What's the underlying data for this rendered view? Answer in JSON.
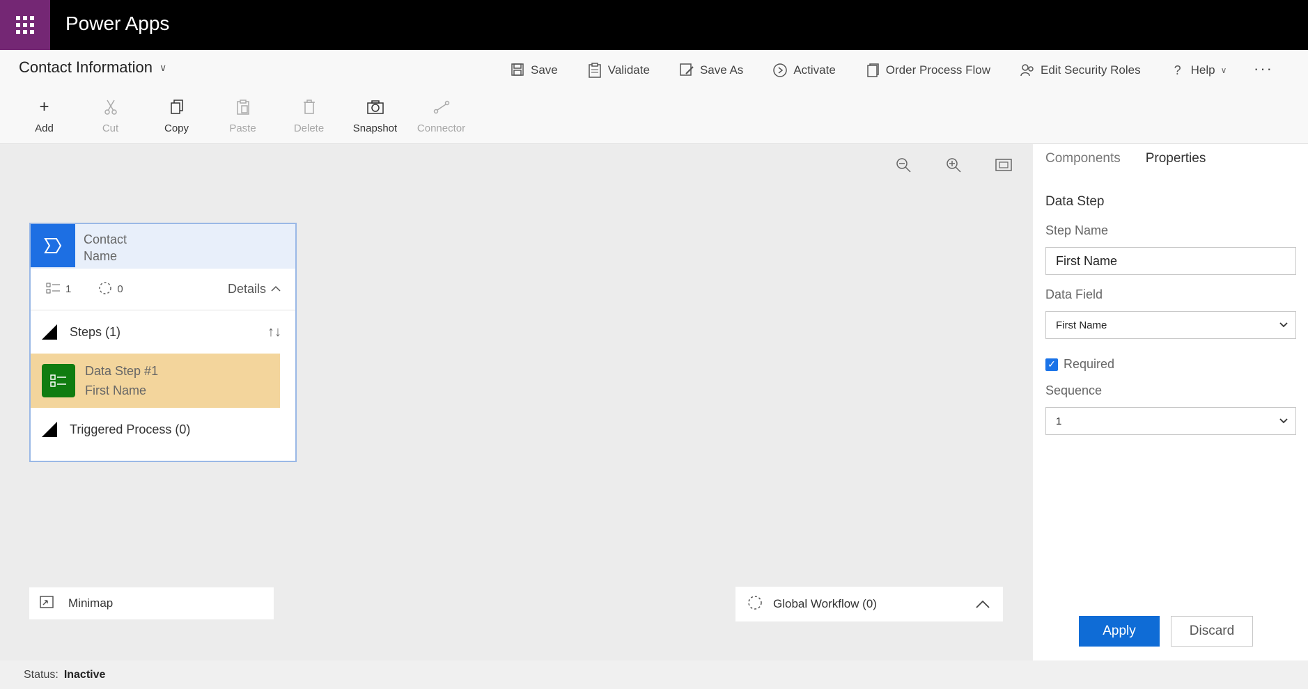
{
  "app": {
    "title": "Power Apps"
  },
  "header": {
    "process_name": "Contact Information",
    "actions": [
      {
        "label": "Save",
        "icon": "save-icon"
      },
      {
        "label": "Validate",
        "icon": "clipboard-icon"
      },
      {
        "label": "Save As",
        "icon": "save-as-icon"
      },
      {
        "label": "Activate",
        "icon": "activate-icon"
      },
      {
        "label": "Order Process Flow",
        "icon": "document-icon"
      },
      {
        "label": "Edit Security Roles",
        "icon": "people-icon"
      },
      {
        "label": "Help",
        "icon": "help-icon"
      }
    ],
    "more": "···"
  },
  "toolbar": {
    "add": "Add",
    "cut": "Cut",
    "copy": "Copy",
    "paste": "Paste",
    "delete": "Delete",
    "snapshot": "Snapshot",
    "connector": "Connector"
  },
  "stage": {
    "title_line1": "Contact",
    "title_line2": "Name",
    "steps_count": "1",
    "workflow_count": "0",
    "details_label": "Details",
    "steps_label": "Steps (1)",
    "step_title": "Data Step #1",
    "step_subtitle": "First Name",
    "triggered_label": "Triggered Process (0)"
  },
  "canvas": {
    "minimap_label": "Minimap",
    "global_workflow_label": "Global Workflow (0)"
  },
  "panel": {
    "tabs": [
      "Components",
      "Properties"
    ],
    "active_tab": "Properties",
    "section_title": "Data Step",
    "step_name_label": "Step Name",
    "step_name_value": "First Name",
    "data_field_label": "Data Field",
    "data_field_value": "First Name",
    "required_label": "Required",
    "required_checked": true,
    "sequence_label": "Sequence",
    "sequence_value": "1",
    "apply_label": "Apply",
    "discard_label": "Discard"
  },
  "status": {
    "label": "Status:",
    "value": "Inactive"
  },
  "colors": {
    "waffle_bg": "#742774",
    "primary": "#0f6cd6",
    "stage_icon": "#1d6fe3",
    "step_highlight": "#f3d59c",
    "step_icon": "#107c10"
  }
}
